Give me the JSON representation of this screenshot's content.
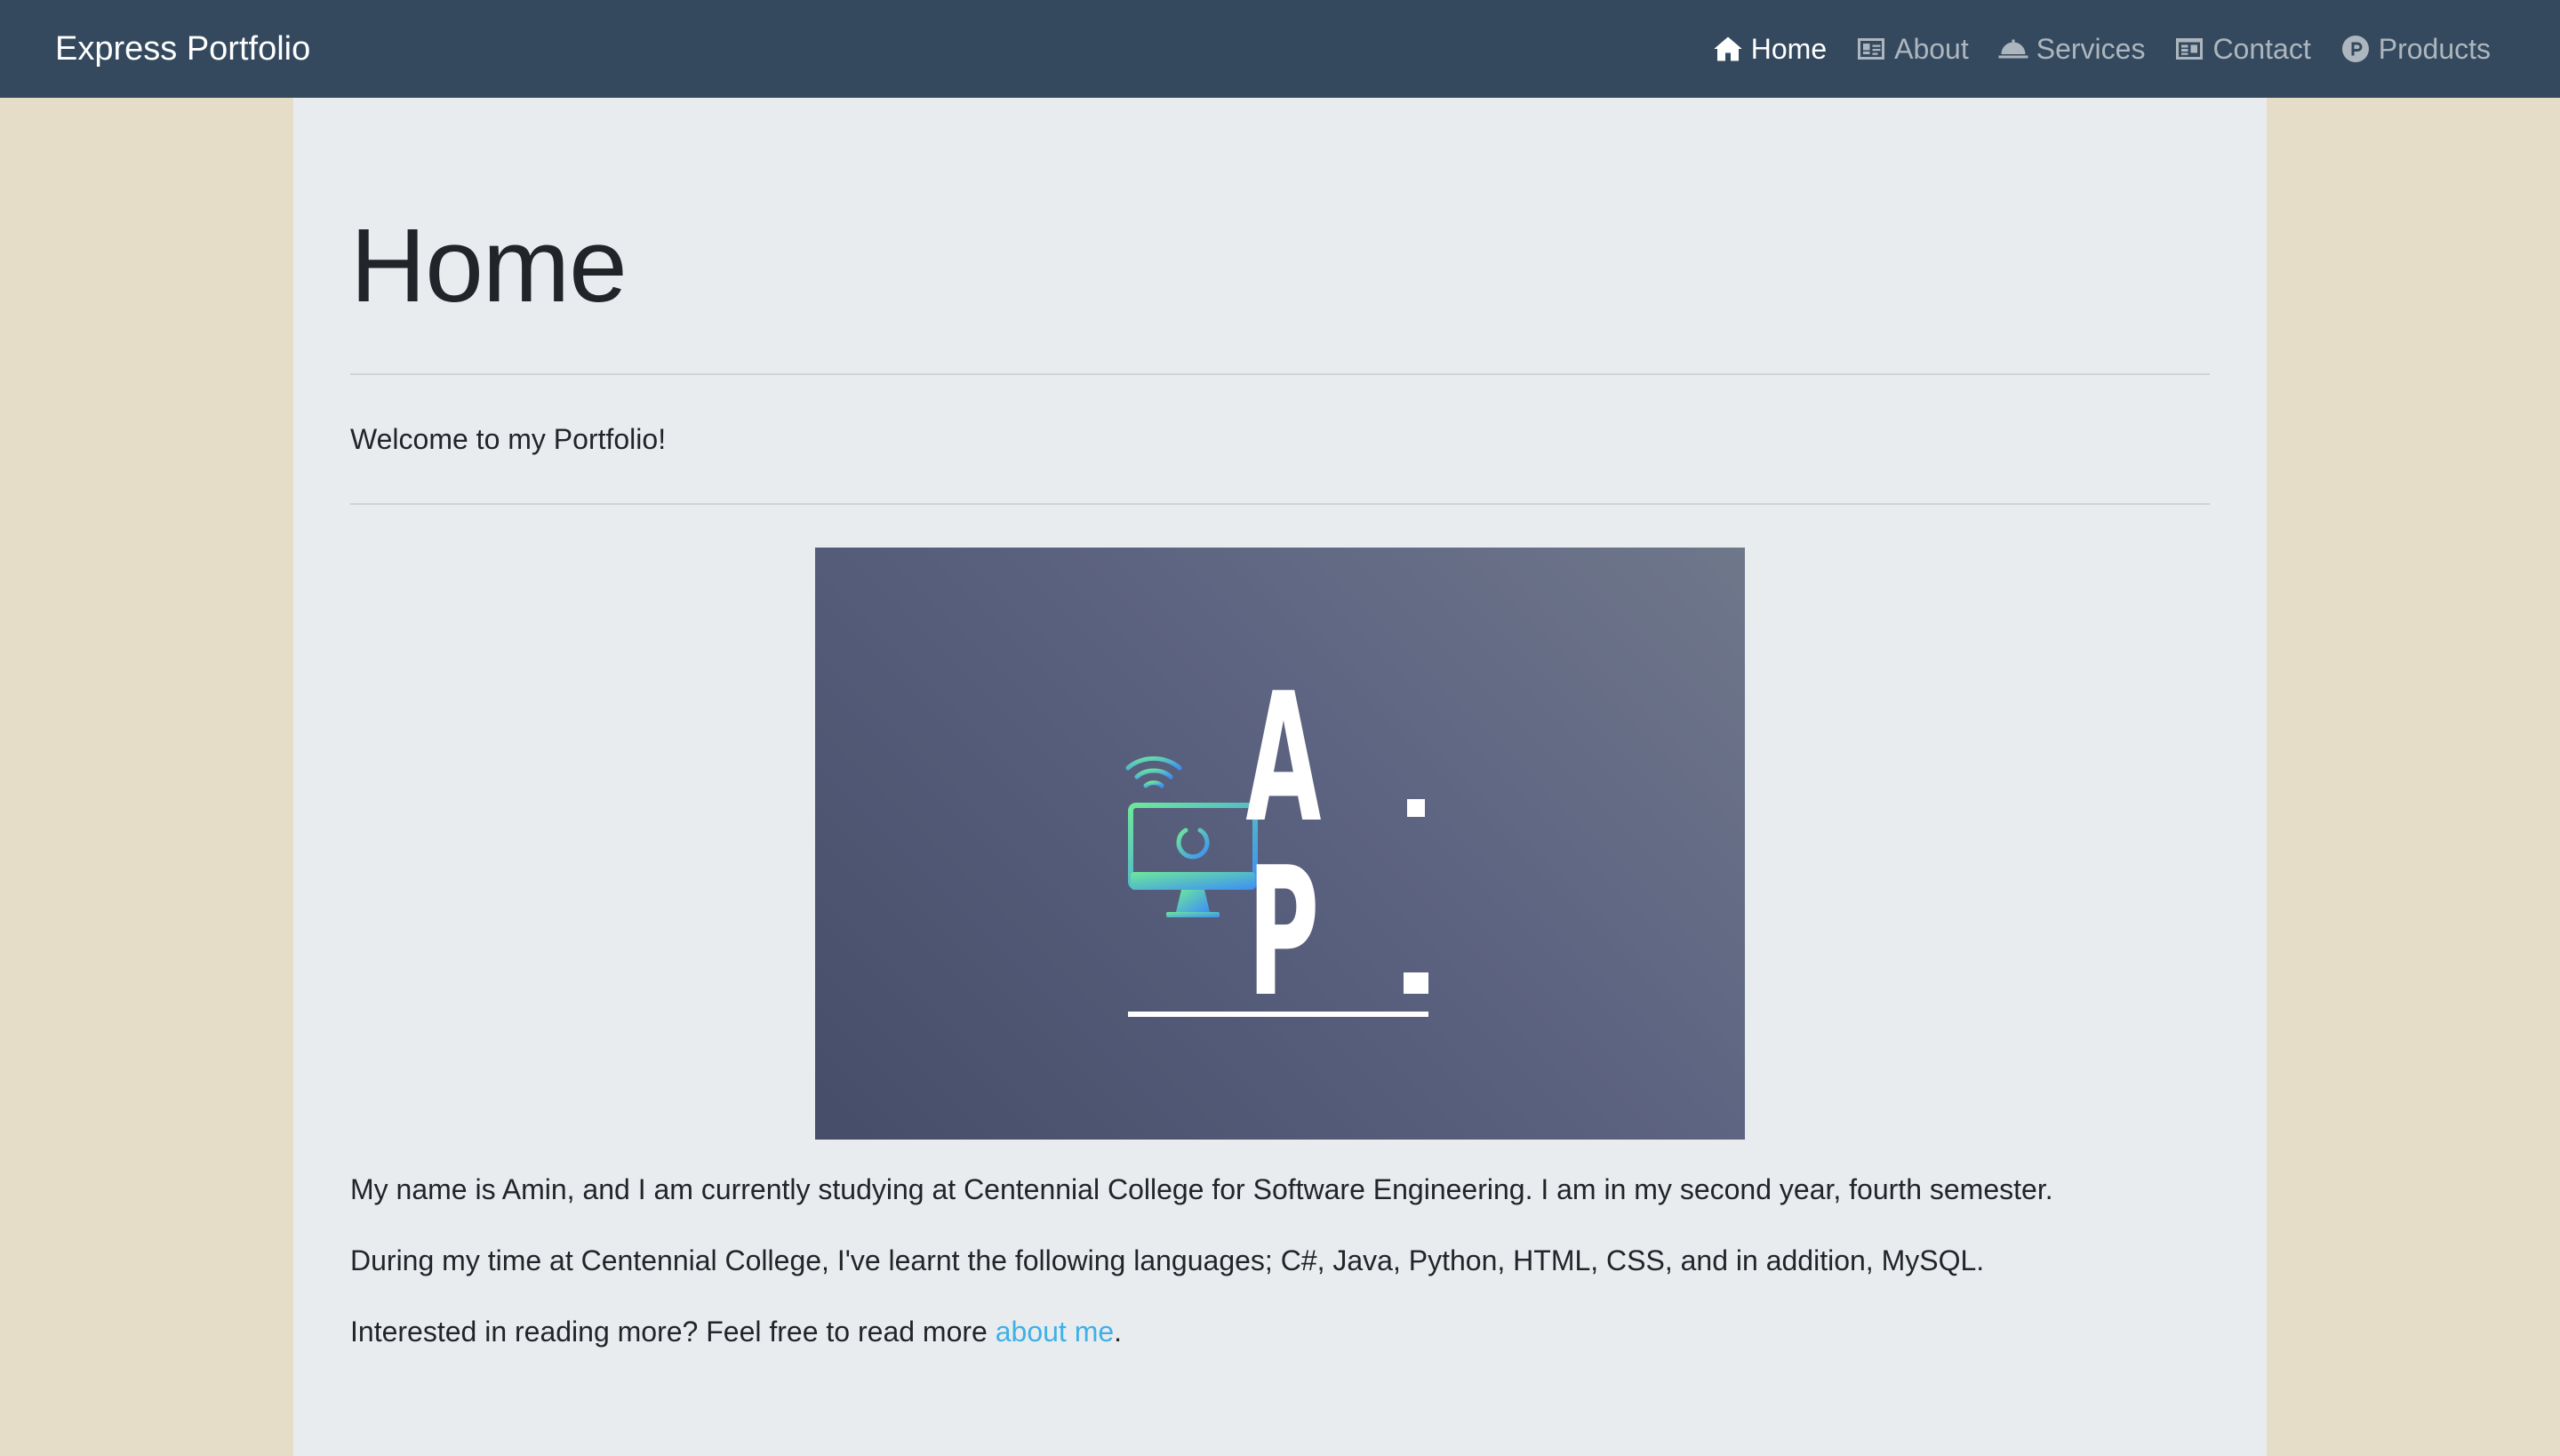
{
  "navbar": {
    "brand": "Express Portfolio",
    "links": [
      {
        "label": "Home",
        "icon": "home-icon",
        "active": true
      },
      {
        "label": "About",
        "icon": "id-card-icon",
        "active": false
      },
      {
        "label": "Services",
        "icon": "service-bell-icon",
        "active": false
      },
      {
        "label": "Contact",
        "icon": "contact-card-icon",
        "active": false
      },
      {
        "label": "Products",
        "icon": "product-p-icon",
        "active": false
      }
    ]
  },
  "main": {
    "title": "Home",
    "welcome": "Welcome to my Portfolio!",
    "hero_image": {
      "logo_letters": [
        "A",
        "P"
      ],
      "colors": {
        "gradient_start": "#6de89a",
        "gradient_end": "#3d8ef5"
      }
    },
    "paragraph1": "My name is Amin, and I am currently studying at Centennial College for Software Engineering. I am in my second year, fourth semester.",
    "paragraph2": "During my time at Centennial College, I've learnt the following languages; C#, Java, Python, HTML, CSS, and in addition, MySQL.",
    "paragraph3_prefix": "Interested in reading more? Feel free to read more ",
    "paragraph3_link": "about me",
    "paragraph3_suffix": "."
  },
  "colors": {
    "navbar_bg": "#34495e",
    "page_bg": "#e6ddc8",
    "content_bg": "#e9ecef",
    "link": "#3fb0e6"
  }
}
